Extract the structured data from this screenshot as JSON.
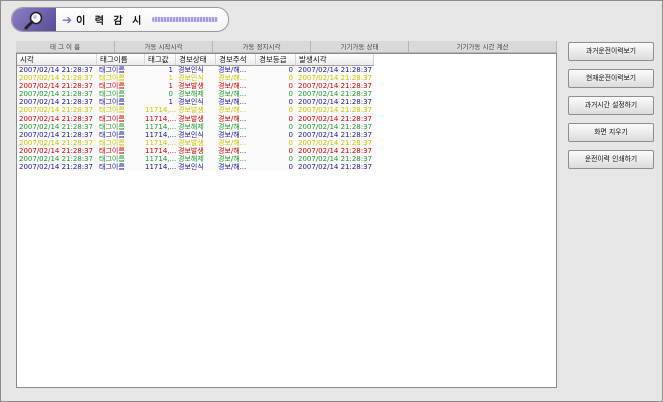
{
  "title": {
    "text": "이 력 감 시",
    "icon": "magnifier-icon",
    "accent": "#6b5bb0"
  },
  "top_header": [
    "태 그  이  름",
    "가동 시작시각",
    "가동 정지시각",
    "기기가동  상태",
    "기기가동 시간 계산"
  ],
  "columns": [
    "시각",
    "태그이름",
    "태그값",
    "경보상태",
    "경보주석",
    "경보등급",
    "발생시각"
  ],
  "colors": {
    "blue": "#1a1a9c",
    "orange": "#e88a00",
    "red": "#cc0000",
    "green": "#1f9a2e",
    "yellow": "#c9c400"
  },
  "rows": [
    {
      "color": "blue",
      "time": "2007/02/14 21:28:37",
      "tag": "태그이름",
      "value": "1",
      "state": "경보인식",
      "note": "경보/해...",
      "grade": "0",
      "occur": "2007/02/14 21:28:37"
    },
    {
      "color": "yellow",
      "time": "2007/02/14 21:28:37",
      "tag": "태그이름",
      "value": "1",
      "state": "경보인식",
      "note": "경보/해...",
      "grade": "0",
      "occur": "2007/02/14 21:28:37"
    },
    {
      "color": "red",
      "time": "2007/02/14 21:28:37",
      "tag": "태그이름",
      "value": "1",
      "state": "경보발생",
      "note": "경보/해...",
      "grade": "0",
      "occur": "2007/02/14 21:28:37"
    },
    {
      "color": "green",
      "time": "2007/02/14 21:28:37",
      "tag": "태그이름",
      "value": "0",
      "state": "경보해제",
      "note": "경보/해...",
      "grade": "0",
      "occur": "2007/02/14 21:28:37"
    },
    {
      "color": "blue",
      "time": "2007/02/14 21:28:37",
      "tag": "태그이름",
      "value": "1",
      "state": "경보인식",
      "note": "경보/해...",
      "grade": "0",
      "occur": "2007/02/14 21:28:37"
    },
    {
      "color": "yellow",
      "time": "2007/02/14 21:28:37",
      "tag": "태그이름",
      "value": "11714,...",
      "state": "경보발생",
      "note": "경보/해...",
      "grade": "0",
      "occur": "2007/02/14 21:28:37"
    },
    {
      "color": "red",
      "time": "2007/02/14 21:28:37",
      "tag": "태그이름",
      "value": "11714,...",
      "state": "경보발생",
      "note": "경보/해...",
      "grade": "0",
      "occur": "2007/02/14 21:28:37"
    },
    {
      "color": "green",
      "time": "2007/02/14 21:28:37",
      "tag": "태그이름",
      "value": "11714,...",
      "state": "경보해제",
      "note": "경보/해...",
      "grade": "0",
      "occur": "2007/02/14 21:28:37"
    },
    {
      "color": "blue",
      "time": "2007/02/14 21:28:37",
      "tag": "태그이름",
      "value": "11714,...",
      "state": "경보인식",
      "note": "경보/해...",
      "grade": "0",
      "occur": "2007/02/14 21:28:37"
    },
    {
      "color": "yellow",
      "time": "2007/02/14 21:28:37",
      "tag": "태그이름",
      "value": "11714,...",
      "state": "경보발생",
      "note": "경보/해...",
      "grade": "0",
      "occur": "2007/02/14 21:28:37"
    },
    {
      "color": "red",
      "time": "2007/02/14 21:28:37",
      "tag": "태그이름",
      "value": "11714,...",
      "state": "경보발생",
      "note": "경보/해...",
      "grade": "0",
      "occur": "2007/02/14 21:28:37"
    },
    {
      "color": "green",
      "time": "2007/02/14 21:28:37",
      "tag": "태그이름",
      "value": "11714,...",
      "state": "경보해제",
      "note": "경보/해...",
      "grade": "0",
      "occur": "2007/02/14 21:28:37"
    },
    {
      "color": "blue",
      "time": "2007/02/14 21:28:37",
      "tag": "태그이름",
      "value": "11714,...",
      "state": "경보인식",
      "note": "경보/해...",
      "grade": "0",
      "occur": "2007/02/14 21:28:37"
    }
  ],
  "buttons": [
    "과거운전이력보기",
    "현재운전이력보기",
    "과거시간 설정하기",
    "화면 지우기",
    "운전이력 인쇄하기"
  ]
}
